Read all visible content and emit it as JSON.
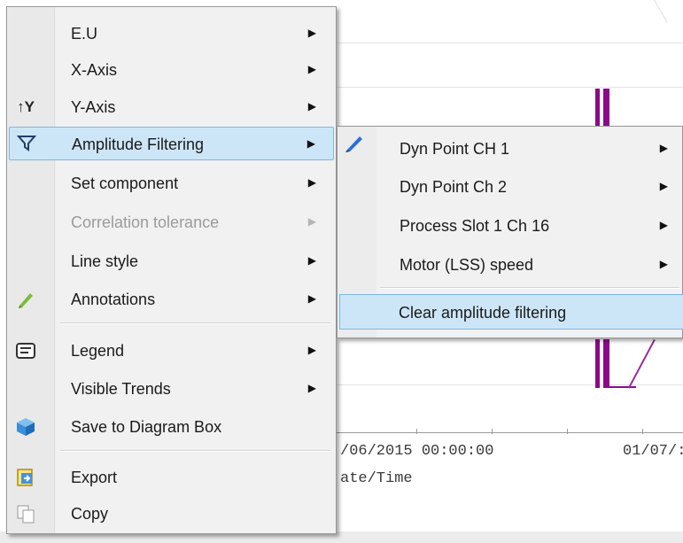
{
  "main_menu": {
    "items": [
      {
        "label": "E.U",
        "has_submenu": true,
        "enabled": true,
        "icon": null
      },
      {
        "label": "X-Axis",
        "has_submenu": true,
        "enabled": true,
        "icon": null
      },
      {
        "label": "Y-Axis",
        "has_submenu": true,
        "enabled": true,
        "icon": "y-axis-icon"
      },
      {
        "label": "Amplitude Filtering",
        "has_submenu": true,
        "enabled": true,
        "icon": "filter-icon",
        "highlighted": true
      },
      {
        "label": "Set component",
        "has_submenu": true,
        "enabled": true,
        "icon": null
      },
      {
        "label": "Correlation tolerance",
        "has_submenu": true,
        "enabled": false,
        "icon": null
      },
      {
        "label": "Line style",
        "has_submenu": true,
        "enabled": true,
        "icon": null
      },
      {
        "label": "Annotations",
        "has_submenu": true,
        "enabled": true,
        "icon": "pencil-icon"
      },
      {
        "label": "Legend",
        "has_submenu": true,
        "enabled": true,
        "icon": "legend-icon"
      },
      {
        "label": "Visible Trends",
        "has_submenu": true,
        "enabled": true,
        "icon": null
      },
      {
        "label": "Save to Diagram Box",
        "has_submenu": false,
        "enabled": true,
        "icon": "cube-icon"
      },
      {
        "label": "Export",
        "has_submenu": false,
        "enabled": true,
        "icon": "export-icon"
      },
      {
        "label": "Copy",
        "has_submenu": false,
        "enabled": true,
        "icon": "copy-icon"
      }
    ],
    "y_axis_glyph": "↑Y",
    "submenu_arrow": "▶"
  },
  "sub_menu": {
    "items": [
      {
        "label": "Dyn Point CH 1",
        "has_submenu": true
      },
      {
        "label": "Dyn Point Ch 2",
        "has_submenu": true
      },
      {
        "label": "Process Slot 1 Ch 16",
        "has_submenu": true
      },
      {
        "label": "Motor (LSS) speed",
        "has_submenu": true
      },
      {
        "label": "Clear amplitude filtering",
        "has_submenu": false,
        "highlighted": true
      }
    ]
  },
  "chart": {
    "x_tick_1": "/06/2015 00:00:00",
    "x_tick_2": "01/07/:",
    "x_axis_label": "ate/Time",
    "series_color": "#8b0a8b"
  }
}
